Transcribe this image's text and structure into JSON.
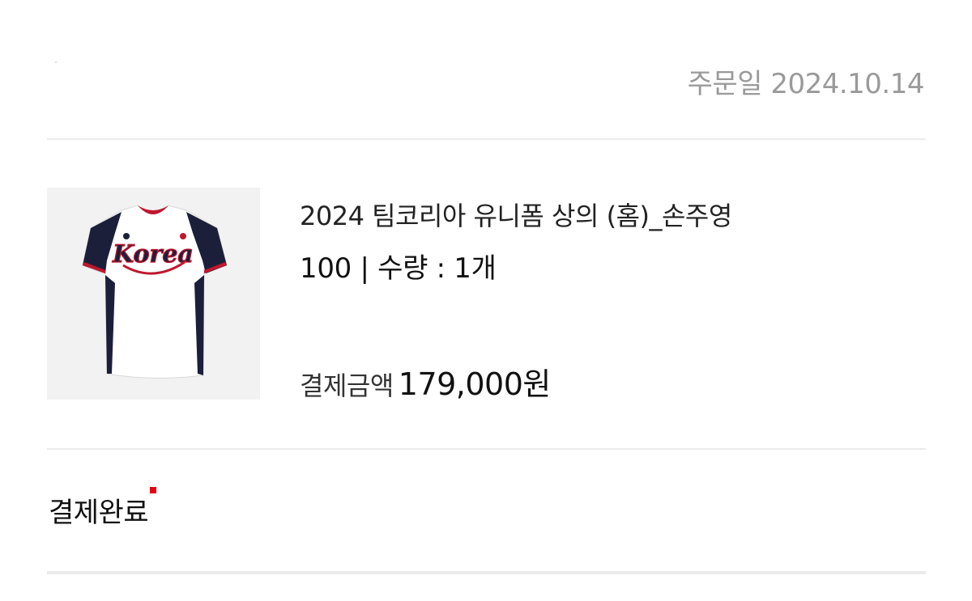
{
  "order": {
    "date_label": "주문일 2024.10.14"
  },
  "product": {
    "name": "2024 팀코리아 유니폼 상의 (홈)_손주영",
    "option": "100 | 수량 : 1개",
    "price_label": "결제금액",
    "price_value": "179,000원",
    "image_icon": "baseball-jersey",
    "jersey_text": "Korea"
  },
  "status": {
    "label": "결제완료",
    "indicator_color": "#e60012"
  },
  "colors": {
    "date_gray": "#9a9a9a",
    "divider": "#ececec",
    "jersey_navy": "#1c1f3a",
    "jersey_red": "#c0172d"
  }
}
